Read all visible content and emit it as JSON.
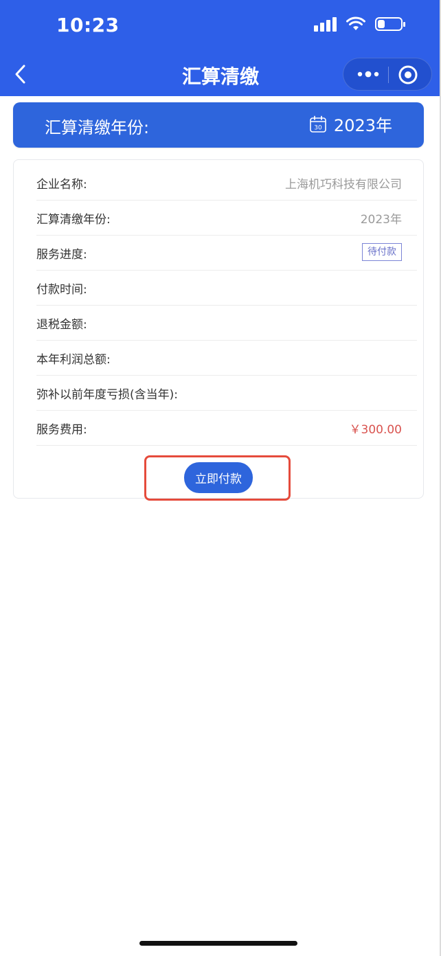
{
  "status_bar": {
    "time": "10:23",
    "battery_level": 0.3
  },
  "nav": {
    "title": "汇算清缴"
  },
  "icons": {
    "back": "chevron-left-icon",
    "more": "more-dots-icon",
    "close": "mini-program-close-icon",
    "calendar": "calendar-icon"
  },
  "banner": {
    "label": "汇算清缴年份:",
    "year": "2023年"
  },
  "calendar_day": "30",
  "details": {
    "company_label": "企业名称:",
    "company_value": "上海机巧科技有限公司",
    "year_label": "汇算清缴年份:",
    "year_value": "2023年",
    "progress_label": "服务进度:",
    "progress_value": "待付款",
    "payment_time_label": "付款时间:",
    "payment_time_value": "",
    "refund_label": "退税金额:",
    "refund_value": "",
    "profit_label": "本年利润总额:",
    "profit_value": "",
    "loss_label": "弥补以前年度亏损(含当年):",
    "loss_value": "",
    "fee_label": "服务费用:",
    "fee_value": "￥300.00"
  },
  "actions": {
    "pay_label": "立即付款"
  },
  "colors": {
    "brand_blue": "#2e5fe8",
    "button_blue": "#2e65dc",
    "fee_red": "#d9534f",
    "highlight_red": "#e54b3c",
    "badge_purple": "#6a72c9"
  }
}
